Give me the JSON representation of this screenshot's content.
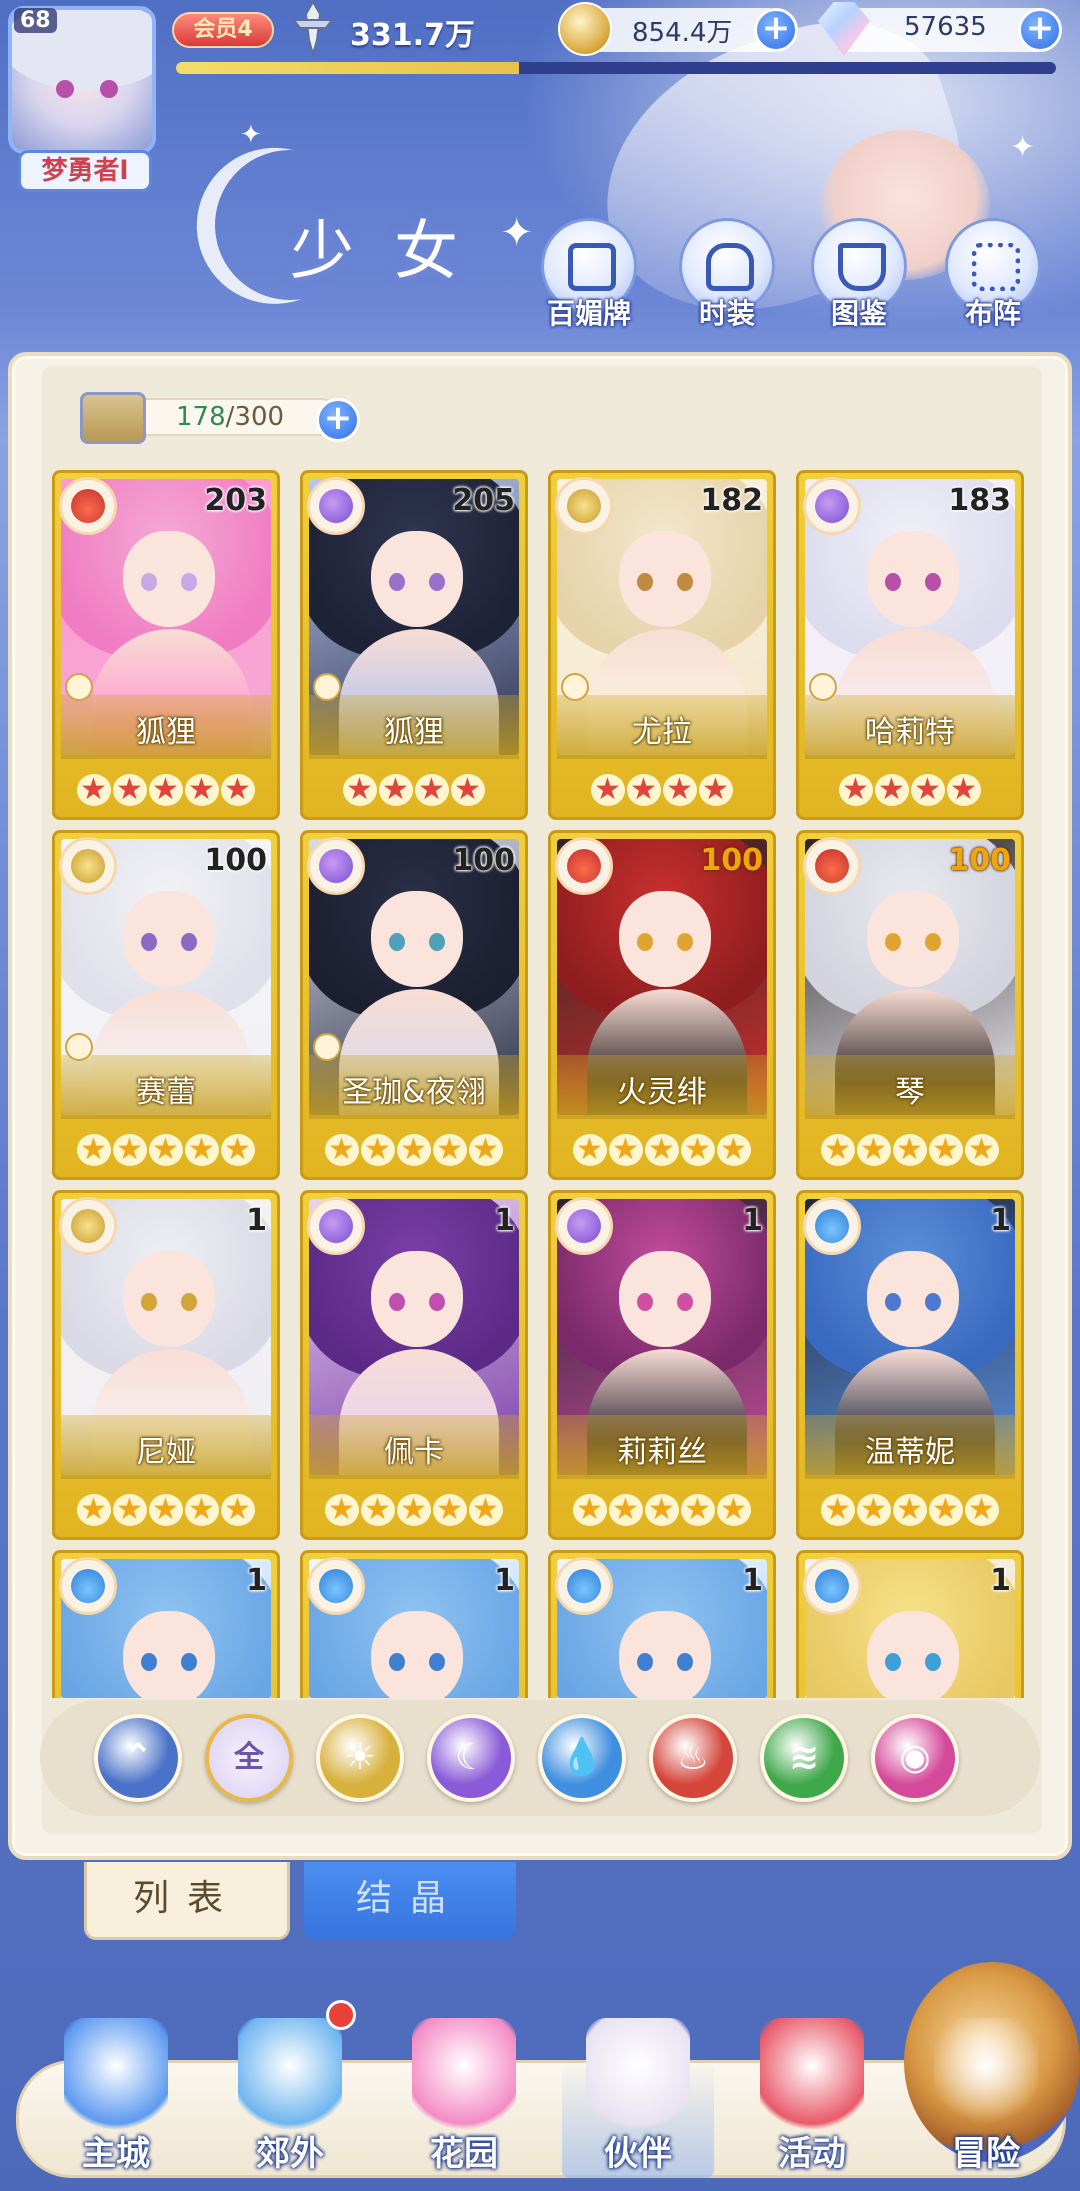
{
  "player": {
    "level": "68",
    "name": "梦勇者l",
    "vip": "会员4",
    "power": "331.7万",
    "exp_fraction": 0.39
  },
  "resources": {
    "gold": "854.4万",
    "gems": "57635"
  },
  "header": {
    "title": "少女",
    "buttons": [
      "百媚牌",
      "时装",
      "图鉴",
      "布阵"
    ]
  },
  "capacity": {
    "current": "178",
    "max": "/300"
  },
  "cards": [
    {
      "name": "狐狸",
      "level": "203",
      "element": "fire",
      "stars": 5,
      "star_color": "red",
      "level_color": "dark"
    },
    {
      "name": "狐狸",
      "level": "205",
      "element": "moon",
      "stars": 4,
      "star_color": "red",
      "level_color": "dark"
    },
    {
      "name": "尤拉",
      "level": "182",
      "element": "sun",
      "stars": 4,
      "star_color": "red",
      "level_color": "dark"
    },
    {
      "name": "哈莉特",
      "level": "183",
      "element": "moon",
      "stars": 4,
      "star_color": "red",
      "level_color": "dark"
    },
    {
      "name": "赛蕾",
      "level": "100",
      "element": "sun",
      "stars": 5,
      "star_color": "gold",
      "level_color": "dark"
    },
    {
      "name": "圣珈&夜翎",
      "level": "100",
      "element": "moon",
      "stars": 5,
      "star_color": "gold",
      "level_color": "dark"
    },
    {
      "name": "火灵绯",
      "level": "100",
      "element": "fire",
      "stars": 5,
      "star_color": "gold",
      "level_color": "orange"
    },
    {
      "name": "琴",
      "level": "100",
      "element": "fire",
      "stars": 5,
      "star_color": "gold",
      "level_color": "orange"
    },
    {
      "name": "尼娅",
      "level": "1",
      "element": "sun",
      "stars": 5,
      "star_color": "gold",
      "level_color": "dark"
    },
    {
      "name": "佩卡",
      "level": "1",
      "element": "moon",
      "stars": 5,
      "star_color": "gold",
      "level_color": "dark"
    },
    {
      "name": "莉莉丝",
      "level": "1",
      "element": "moon",
      "stars": 5,
      "star_color": "gold",
      "level_color": "dark"
    },
    {
      "name": "温蒂妮",
      "level": "1",
      "element": "water",
      "stars": 5,
      "star_color": "gold",
      "level_color": "dark"
    },
    {
      "name": "",
      "level": "1",
      "element": "water",
      "stars": 0,
      "star_color": "gold",
      "level_color": "dark"
    },
    {
      "name": "",
      "level": "1",
      "element": "water",
      "stars": 0,
      "star_color": "gold",
      "level_color": "dark"
    },
    {
      "name": "",
      "level": "1",
      "element": "water",
      "stars": 0,
      "star_color": "gold",
      "level_color": "dark"
    },
    {
      "name": "",
      "level": "1",
      "element": "water",
      "stars": 0,
      "star_color": "gold",
      "level_color": "dark"
    }
  ],
  "filters": [
    {
      "id": "sort",
      "label": "",
      "icon": "sort-icon",
      "color": "#4a72c8"
    },
    {
      "id": "all",
      "label": "全",
      "icon": "all-icon",
      "color": "#ded4f2"
    },
    {
      "id": "sun",
      "label": "",
      "icon": "sun-element-icon",
      "color": "#d8b03c"
    },
    {
      "id": "moon",
      "label": "",
      "icon": "moon-element-icon",
      "color": "#8a5ad8"
    },
    {
      "id": "water",
      "label": "",
      "icon": "water-element-icon",
      "color": "#3f8fe0"
    },
    {
      "id": "fire",
      "label": "",
      "icon": "fire-element-icon",
      "color": "#d4453a"
    },
    {
      "id": "wind",
      "label": "",
      "icon": "wind-element-icon",
      "color": "#3fa84a"
    },
    {
      "id": "chaos",
      "label": "",
      "icon": "chaos-element-icon",
      "color": "#d44a9a"
    }
  ],
  "tabs": {
    "list": "列表",
    "crystal": "结晶"
  },
  "nav": [
    "主城",
    "郊外",
    "花园",
    "伙伴",
    "活动",
    "冒险"
  ],
  "colors": {
    "accent_blue": "#3574dd",
    "card_gold": "#e1b421",
    "star_red": "#e0443a",
    "star_gold": "#f0a818",
    "badge_red": "#e8413a"
  }
}
